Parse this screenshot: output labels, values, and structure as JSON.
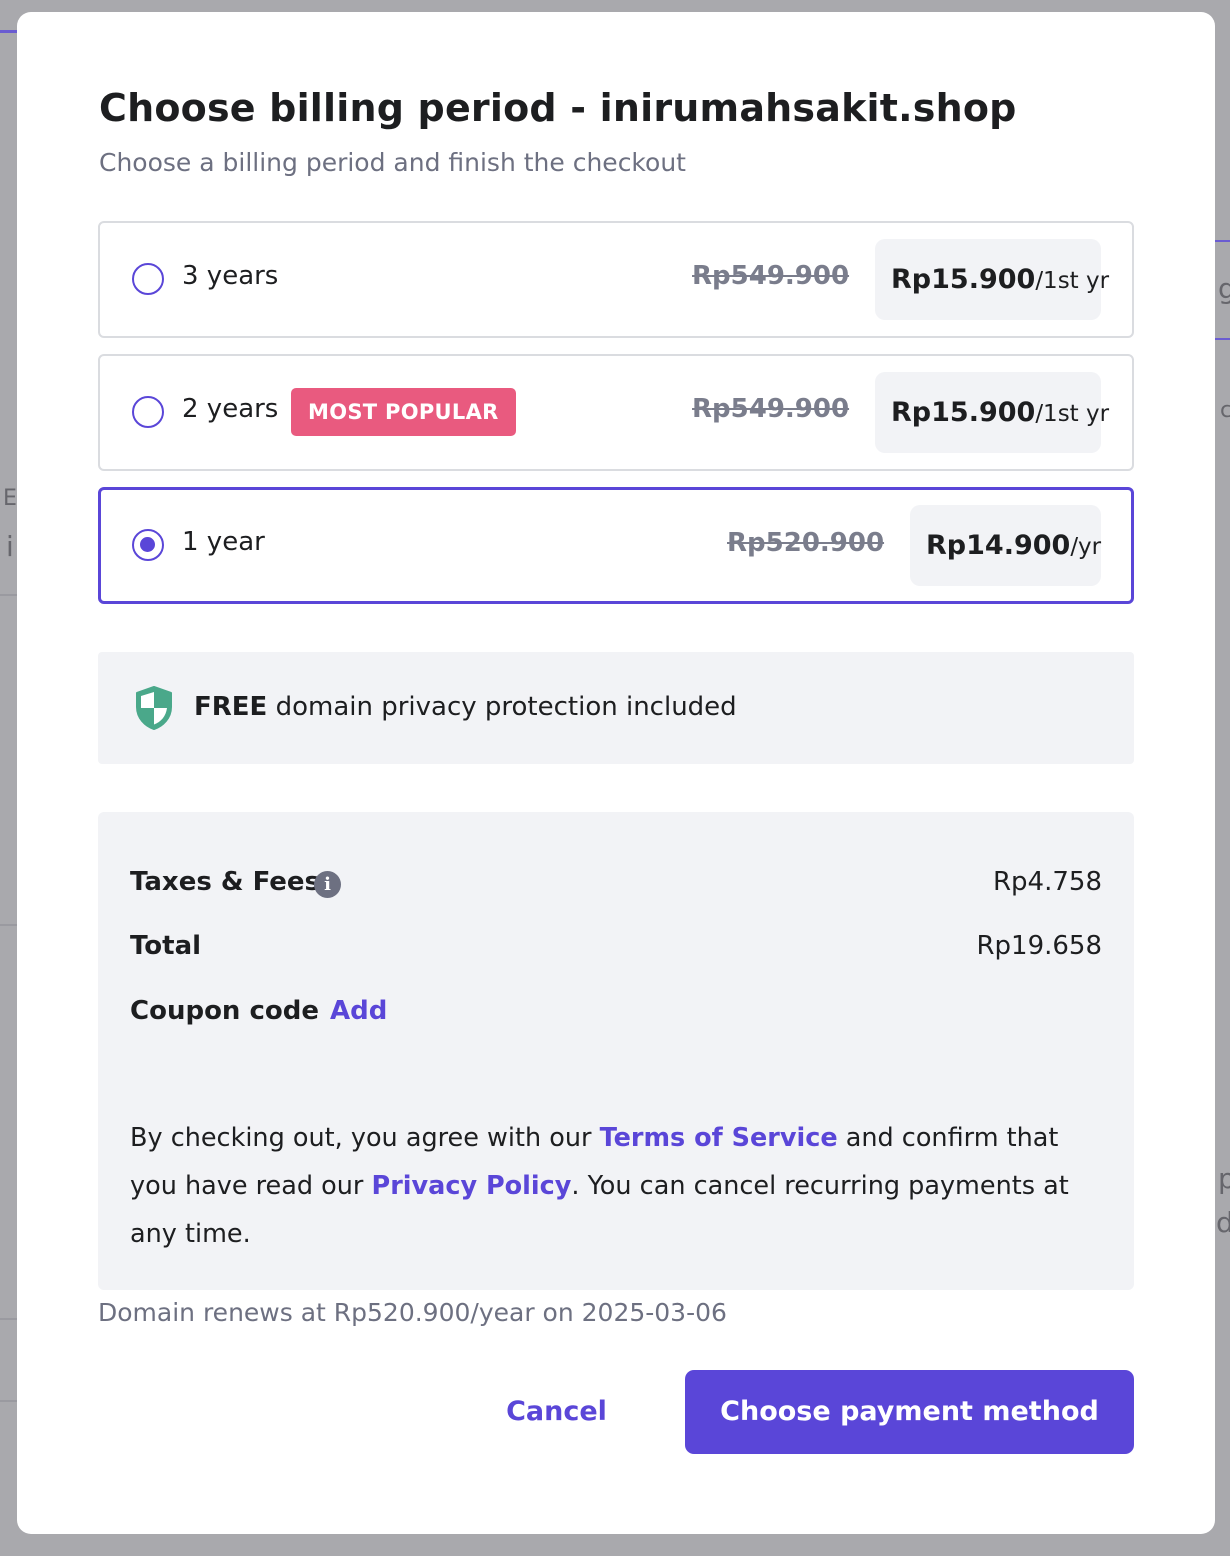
{
  "modal": {
    "title": "Choose billing period - inirumahsakit.shop",
    "subtitle": "Choose a billing period and finish the checkout"
  },
  "options": [
    {
      "label": "3 years",
      "original_price": "Rp549.900",
      "price": "Rp15.900",
      "unit": "/1st yr",
      "selected": false
    },
    {
      "label": "2 years",
      "badge": "MOST POPULAR",
      "original_price": "Rp549.900",
      "price": "Rp15.900",
      "unit": "/1st yr",
      "selected": false
    },
    {
      "label": "1 year",
      "original_price": "Rp520.900",
      "price": "Rp14.900",
      "unit": "/yr",
      "selected": true
    }
  ],
  "privacy": {
    "bold": "FREE",
    "text": " domain privacy protection included",
    "icon": "shield-icon"
  },
  "summary": {
    "taxes_label": "Taxes & Fees",
    "taxes_value": "Rp4.758",
    "info_icon_glyph": "i",
    "total_label": "Total",
    "total_value": "Rp19.658",
    "coupon_label": "Coupon code",
    "coupon_add": "Add"
  },
  "legal": {
    "part1": "By checking out, you agree with our ",
    "terms_link": "Terms of Service",
    "part2": " and confirm that you have read our ",
    "privacy_link": "Privacy Policy",
    "part3": ". You can cancel recurring payments at any time."
  },
  "renewal_note": "Domain renews at Rp520.900/year on 2025-03-06",
  "buttons": {
    "cancel": "Cancel",
    "primary": "Choose payment method"
  },
  "colors": {
    "accent": "#5a46d8",
    "badge": "#e95a7f",
    "shield": "#4aa88a",
    "panel": "#f2f3f6"
  },
  "background": {
    "glyph_e": "E",
    "glyph_i": "i",
    "glyph_g": "g",
    "glyph_c": "c",
    "glyph_p": "p",
    "glyph_d": "d"
  }
}
